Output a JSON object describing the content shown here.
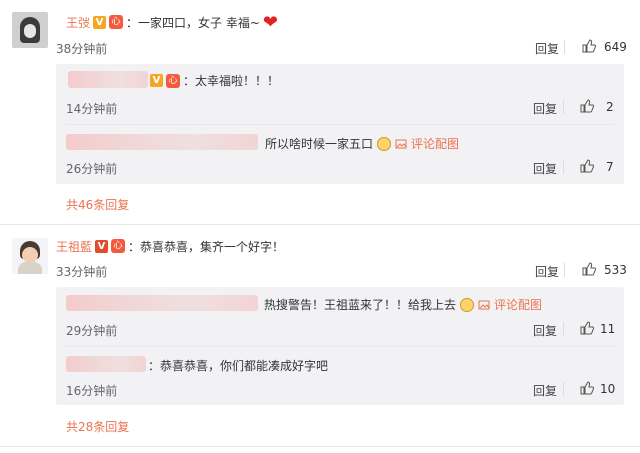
{
  "comments": [
    {
      "user": "王弢",
      "text": "：一家四口，女子 幸福~",
      "time": "38分钟前",
      "reply": "回复",
      "likes": "649",
      "subreplies": [
        {
          "text": "：太幸福啦！！！",
          "time": "14分钟前",
          "reply": "回复",
          "likes": "2"
        },
        {
          "text": "所以啥时候一家五口",
          "pic": "评论配图",
          "time": "26分钟前",
          "reply": "回复",
          "likes": "7"
        }
      ],
      "more": "共46条回复"
    },
    {
      "user": "王祖藍",
      "text": "：恭喜恭喜，集齐一个好字！",
      "time": "33分钟前",
      "reply": "回复",
      "likes": "533",
      "subreplies": [
        {
          "text": "热搜警告！王祖蓝来了！！给我上去",
          "pic": "评论配图",
          "time": "29分钟前",
          "reply": "回复",
          "likes": "11"
        },
        {
          "text": "：恭喜恭喜，你们都能凑成好字吧",
          "time": "16分钟前",
          "reply": "回复",
          "likes": "10"
        }
      ],
      "more": "共28条回复"
    }
  ],
  "badges": {
    "v": "V",
    "gift": "心"
  },
  "icons": {
    "thumb": "thumbs-up-icon",
    "heart": "heart-icon",
    "dog": "dog-emoji-icon",
    "picture": "picture-icon"
  },
  "colors": {
    "accent": "#eb7350",
    "subbox": "#f2f2f5",
    "heart": "#e0241f"
  }
}
